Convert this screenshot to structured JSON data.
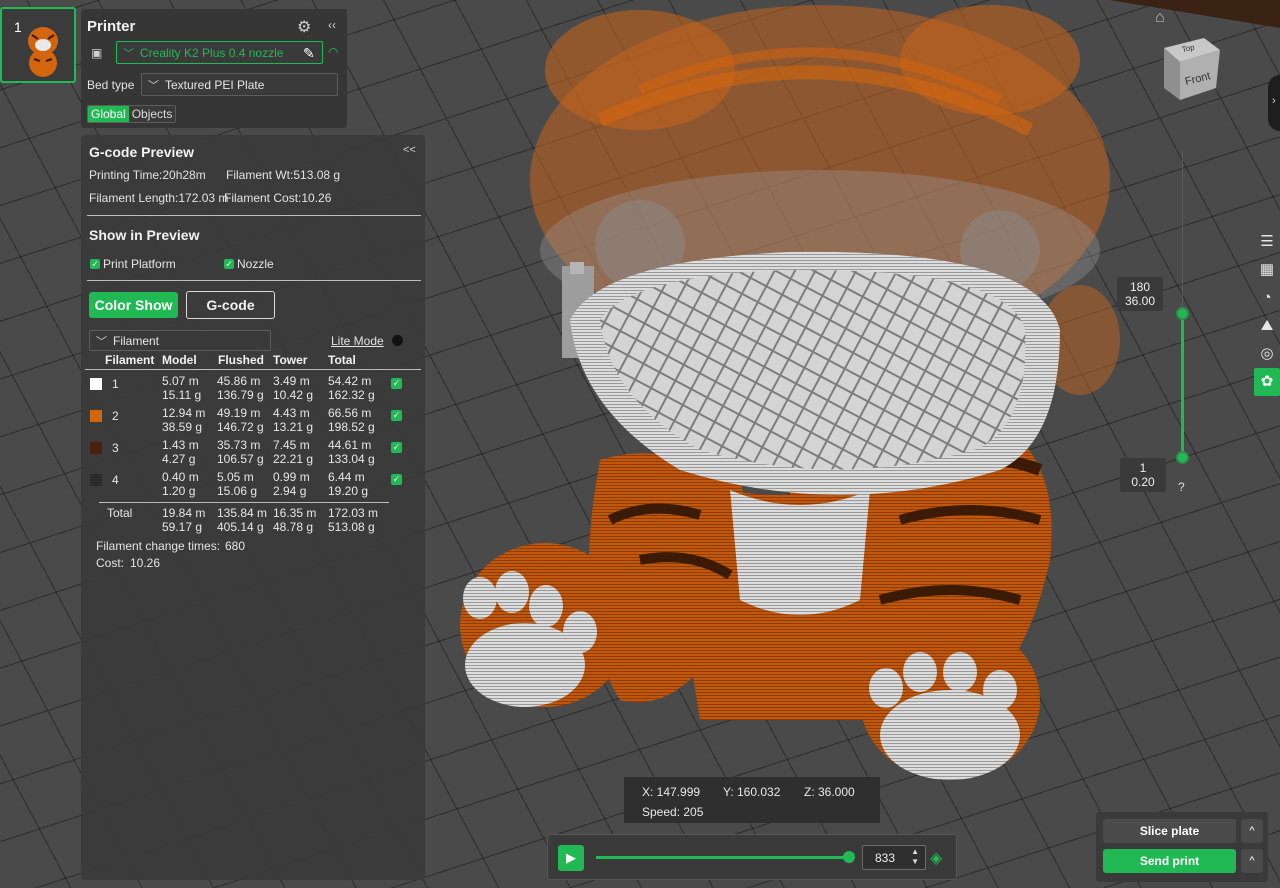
{
  "plate": {
    "number": "1"
  },
  "printer": {
    "title": "Printer",
    "preset": "Creality K2 Plus 0.4 nozzle",
    "bed_type_label": "Bed type",
    "bed_type": "Textured PEI Plate",
    "scope_tabs": [
      "Global",
      "Objects"
    ],
    "active_scope": "Global"
  },
  "gcode_preview": {
    "title": "G-code Preview",
    "collapse": "<<",
    "printing_time": "Printing Time:20h28m",
    "filament_wt": "Filament Wt:513.08 g",
    "filament_length": "Filament Length:172.03 m",
    "filament_cost": "Filament Cost:10.26",
    "show_title": "Show in Preview",
    "show_print_platform": "Print Platform",
    "show_nozzle": "Nozzle",
    "color_show_btn": "Color Show",
    "gcode_btn": "G-code",
    "view_select": "Filament",
    "lite_mode": "Lite Mode",
    "columns": [
      "Filament",
      "Model",
      "Flushed",
      "Tower",
      "Total"
    ],
    "rows": [
      {
        "id": "1",
        "color": "#ffffff",
        "model": [
          "5.07 m",
          "15.11 g"
        ],
        "flushed": [
          "45.86 m",
          "136.79 g"
        ],
        "tower": [
          "3.49 m",
          "10.42 g"
        ],
        "total": [
          "54.42 m",
          "162.32 g"
        ]
      },
      {
        "id": "2",
        "color": "#d4650f",
        "model": [
          "12.94 m",
          "38.59 g"
        ],
        "flushed": [
          "49.19 m",
          "146.72 g"
        ],
        "tower": [
          "4.43 m",
          "13.21 g"
        ],
        "total": [
          "66.56 m",
          "198.52 g"
        ]
      },
      {
        "id": "3",
        "color": "#4a2108",
        "model": [
          "1.43 m",
          "4.27 g"
        ],
        "flushed": [
          "35.73 m",
          "106.57 g"
        ],
        "tower": [
          "7.45 m",
          "22.21 g"
        ],
        "total": [
          "44.61 m",
          "133.04 g"
        ]
      },
      {
        "id": "4",
        "color": "#2b2b2b",
        "model": [
          "0.40 m",
          "1.20 g"
        ],
        "flushed": [
          "5.05 m",
          "15.06 g"
        ],
        "tower": [
          "0.99 m",
          "2.94 g"
        ],
        "total": [
          "6.44 m",
          "19.20 g"
        ]
      }
    ],
    "total_label": "Total",
    "totals": {
      "model": [
        "19.84 m",
        "59.17 g"
      ],
      "flushed": [
        "135.84 m",
        "405.14 g"
      ],
      "tower": [
        "16.35 m",
        "48.78 g"
      ],
      "total": [
        "172.03 m",
        "513.08 g"
      ]
    },
    "change_times_label": "Filament change times:",
    "change_times": "680",
    "cost_label": "Cost:",
    "cost": "10.26"
  },
  "nav_cube": {
    "top": "Top",
    "front": "Front"
  },
  "layer_slider": {
    "top_layer": "180",
    "top_height": "36.00",
    "bottom_layer": "1",
    "bottom_height": "0.20",
    "help": "?"
  },
  "coords": {
    "x": "X: 147.999",
    "y": "Y: 160.032",
    "z": "Z: 36.000",
    "speed": "Speed: 205"
  },
  "move_slider": {
    "value": "833"
  },
  "actions": {
    "slice": "Slice plate",
    "send": "Send print",
    "caret": "^"
  },
  "colors": {
    "accent": "#21b954",
    "orange": "#d4650f",
    "dark_brown": "#4a2108",
    "white_filament": "#e8e8e8"
  },
  "icons": [
    "home-icon",
    "gear-icon",
    "collapse-icon",
    "edit-icon",
    "wifi-icon",
    "play-icon",
    "layers-icon"
  ]
}
